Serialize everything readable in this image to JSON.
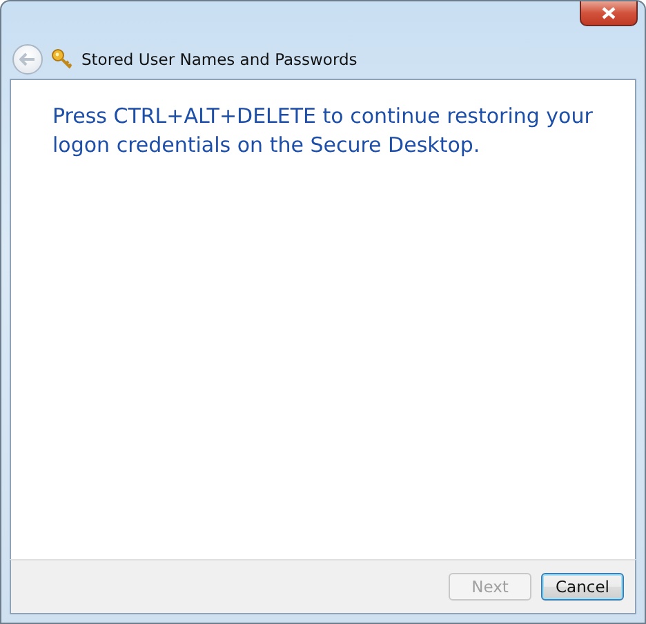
{
  "window": {
    "title": "Stored User Names and Passwords"
  },
  "message": "Press CTRL+ALT+DELETE to continue restoring your logon credentials on the Secure Desktop.",
  "buttons": [
    {
      "label": "Next",
      "disabled": true,
      "default": false
    },
    {
      "label": "Cancel",
      "disabled": false,
      "default": true
    }
  ]
}
